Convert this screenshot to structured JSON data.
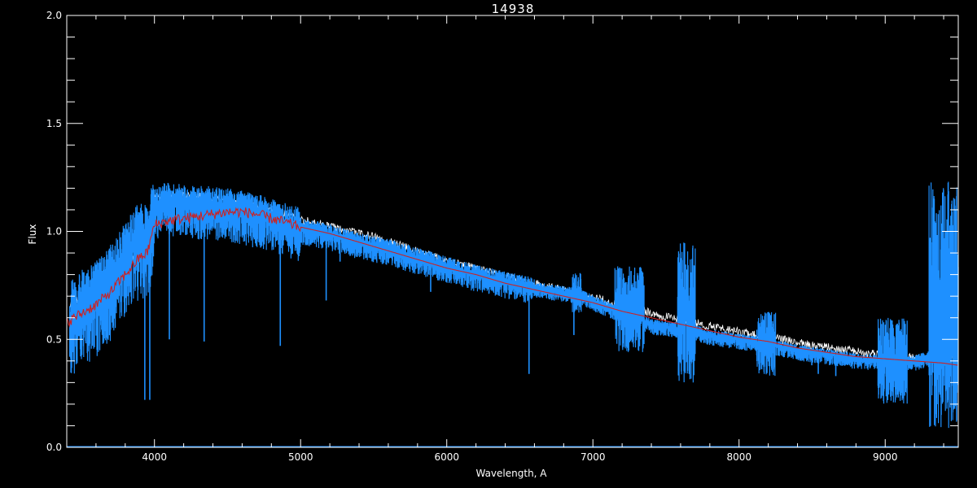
{
  "chart_data": {
    "type": "line",
    "title": "14938",
    "xlabel": "Wavelength, A",
    "ylabel": "Flux",
    "xlim": [
      3400,
      9500
    ],
    "ylim": [
      0.0,
      2.0
    ],
    "x_ticks": [
      4000,
      5000,
      6000,
      7000,
      8000,
      9000
    ],
    "x_tick_labels": [
      "4000",
      "5000",
      "6000",
      "7000",
      "8000",
      "9000"
    ],
    "x_minor_step": 200,
    "y_ticks": [
      0.0,
      0.5,
      1.0,
      1.5,
      2.0
    ],
    "y_tick_labels": [
      "0.0",
      "0.5",
      "1.0",
      "1.5",
      "2.0"
    ],
    "y_minor_step": 0.1,
    "grid": false,
    "colors": {
      "background": "#000000",
      "axes": "#ffffff",
      "observed": "#1e90ff",
      "model_envelope": "#ffffff",
      "fit": "#cc2222"
    },
    "series": [
      {
        "role": "white-envelope",
        "x": [
          3420,
          3600,
          3800,
          3950,
          4000,
          4200,
          4500,
          4800,
          5000,
          5500,
          6000,
          6500,
          7000,
          7500,
          8000,
          8500,
          9000,
          9500
        ],
        "values": [
          0.66,
          0.72,
          0.83,
          0.95,
          1.15,
          1.17,
          1.14,
          1.1,
          1.05,
          0.97,
          0.86,
          0.77,
          0.69,
          0.6,
          0.53,
          0.47,
          0.42,
          0.4
        ]
      },
      {
        "role": "blue-observed",
        "x": [
          3420,
          3500,
          3600,
          3700,
          3800,
          3900,
          3950,
          4000,
          4100,
          4200,
          4300,
          4400,
          4500,
          4600,
          4700,
          4800,
          4900,
          5000,
          5200,
          5400,
          5600,
          5800,
          6000,
          6200,
          6400,
          6600,
          6800,
          6900,
          7000,
          7200,
          7400,
          7600,
          7650,
          7800,
          8000,
          8200,
          8400,
          8600,
          8800,
          9000,
          9100,
          9200,
          9300,
          9400,
          9500
        ],
        "values": [
          0.6,
          0.66,
          0.7,
          0.78,
          0.88,
          0.98,
          0.96,
          1.12,
          1.14,
          1.13,
          1.12,
          1.12,
          1.11,
          1.1,
          1.08,
          1.07,
          1.04,
          1.02,
          0.99,
          0.95,
          0.92,
          0.88,
          0.84,
          0.8,
          0.77,
          0.74,
          0.72,
          0.71,
          0.68,
          0.62,
          0.57,
          0.55,
          0.55,
          0.52,
          0.5,
          0.48,
          0.45,
          0.43,
          0.41,
          0.4,
          0.4,
          0.4,
          0.42,
          0.4,
          0.38
        ]
      },
      {
        "role": "red-fit",
        "x": [
          3400,
          3500,
          3600,
          3700,
          3800,
          3900,
          3950,
          4000,
          4100,
          4200,
          4300,
          4400,
          4500,
          4600,
          4700,
          4800,
          4900,
          5000,
          5200,
          5400,
          5600,
          5800,
          6000,
          6200,
          6400,
          6600,
          6800,
          7000,
          7200,
          7400,
          7600,
          7800,
          8000,
          8200,
          8400,
          8600,
          8800,
          9000,
          9200,
          9400,
          9500
        ],
        "values": [
          0.58,
          0.62,
          0.66,
          0.72,
          0.8,
          0.88,
          0.9,
          1.03,
          1.05,
          1.06,
          1.07,
          1.08,
          1.09,
          1.09,
          1.08,
          1.06,
          1.04,
          1.02,
          0.99,
          0.95,
          0.91,
          0.87,
          0.83,
          0.8,
          0.76,
          0.73,
          0.7,
          0.67,
          0.63,
          0.6,
          0.57,
          0.54,
          0.51,
          0.49,
          0.46,
          0.44,
          0.42,
          0.41,
          0.4,
          0.39,
          0.38
        ]
      }
    ],
    "absorption_lines": [
      {
        "x": 3934,
        "depth": 0.22
      },
      {
        "x": 3968,
        "depth": 0.22
      },
      {
        "x": 4102,
        "depth": 0.5
      },
      {
        "x": 4340,
        "depth": 0.49
      },
      {
        "x": 4861,
        "depth": 0.47
      },
      {
        "x": 5175,
        "depth": 0.68
      },
      {
        "x": 5270,
        "depth": 0.86
      },
      {
        "x": 5890,
        "depth": 0.72
      },
      {
        "x": 6563,
        "depth": 0.34
      },
      {
        "x": 6870,
        "depth": 0.52
      },
      {
        "x": 8498,
        "depth": 0.38
      },
      {
        "x": 8542,
        "depth": 0.34
      },
      {
        "x": 8662,
        "depth": 0.33
      }
    ],
    "noise_regions": [
      {
        "x": [
          6860,
          6920
        ],
        "min": 0.62,
        "max": 0.81
      },
      {
        "x": [
          7150,
          7350
        ],
        "min": 0.44,
        "max": 0.84
      },
      {
        "x": [
          7580,
          7700
        ],
        "min": 0.3,
        "max": 0.96
      },
      {
        "x": [
          8120,
          8250
        ],
        "min": 0.33,
        "max": 0.63
      },
      {
        "x": [
          8950,
          9150
        ],
        "min": 0.2,
        "max": 0.6
      },
      {
        "x": [
          9300,
          9500
        ],
        "min": 0.08,
        "max": 1.24
      }
    ]
  }
}
